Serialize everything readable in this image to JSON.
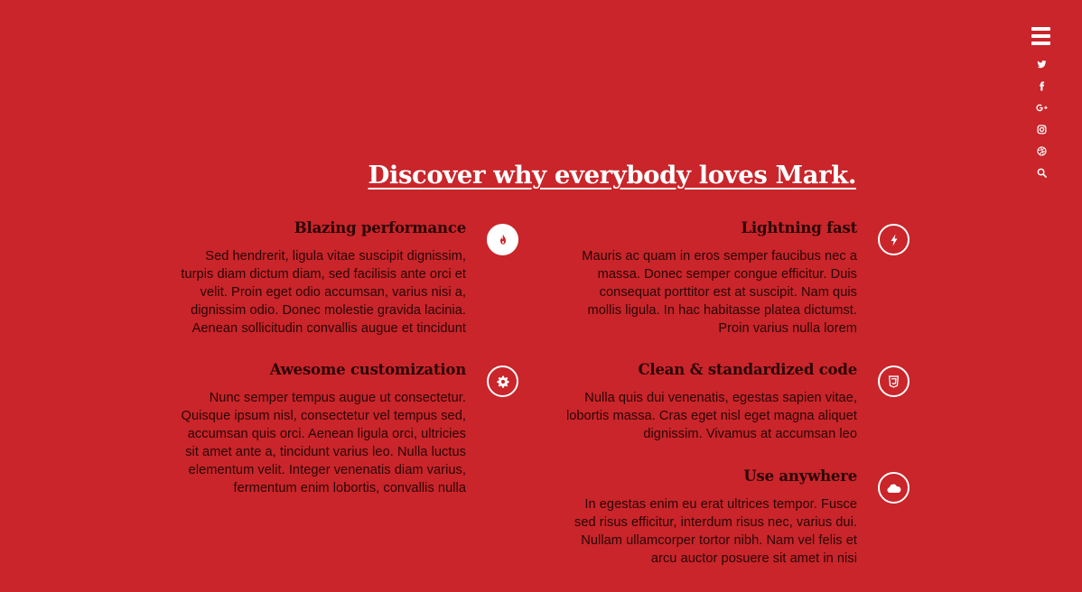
{
  "nav": {
    "menu_icon": "hamburger-menu-icon",
    "social_icons": [
      "twitter-icon",
      "facebook-icon",
      "google-plus-icon",
      "instagram-icon",
      "dribbble-icon",
      "search-icon"
    ]
  },
  "headline": "Discover why everybody loves Mark.",
  "features": [
    {
      "title": "Blazing performance",
      "icon": "flame-icon",
      "text": "Sed hendrerit, ligula vitae suscipit dignissim, turpis diam dictum diam, sed facilisis ante orci et velit. Proin eget odio accumsan, varius nisi a, dignissim odio. Donec molestie gravida lacinia. Aenean sollicitudin convallis augue et tincidunt"
    },
    {
      "title": "Lightning fast",
      "icon": "lightning-icon",
      "text": "Mauris ac quam in eros semper faucibus nec a massa. Donec semper congue efficitur. Duis consequat porttitor est at suscipit. Nam quis mollis ligula. In hac habitasse platea dictumst. Proin varius nulla lorem"
    },
    {
      "title": "Awesome customization",
      "icon": "gear-icon",
      "text": "Nunc semper tempus augue ut consectetur. Quisque ipsum nisl, consectetur vel tempus sed, accumsan quis orci. Aenean ligula orci, ultricies sit amet ante a, tincidunt varius leo. Nulla luctus elementum velit. Integer venenatis diam varius, fermentum enim lobortis, convallis nulla"
    },
    {
      "title": "Clean & standardized code",
      "icon": "css3-icon",
      "text": "Nulla quis dui venenatis, egestas sapien vitae, lobortis massa. Cras eget nisl eget magna aliquet dignissim. Vivamus at accumsan leo"
    },
    {
      "title": "Use anywhere",
      "icon": "cloud-icon",
      "text": "In egestas enim eu erat ultrices tempor. Fusce sed risus efficitur, interdum risus nec, varius dui. Nullam ullamcorper tortor nibh. Nam vel felis et arcu auctor posuere sit amet in nisi"
    }
  ],
  "colors": {
    "background": "#c9252a",
    "text": "#2a0506",
    "accent": "#ffffff"
  }
}
